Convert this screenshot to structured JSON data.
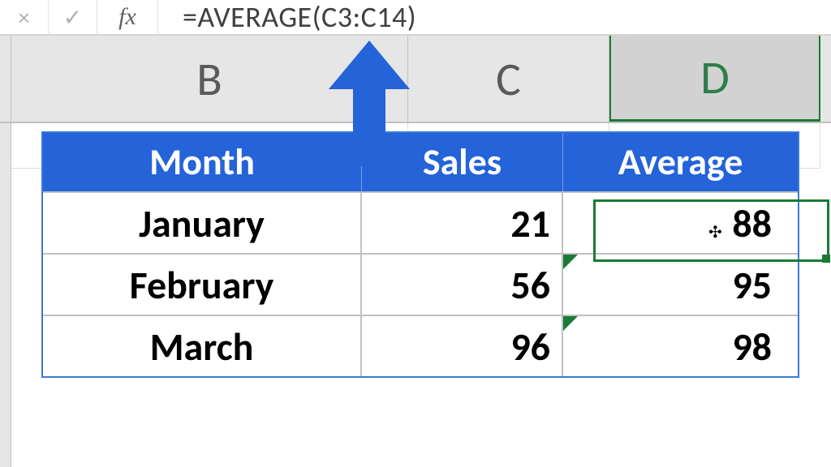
{
  "formula_bar": {
    "cancel_tip": "×",
    "confirm_tip": "✓",
    "fx_label": "fx",
    "formula": "=AVERAGE(C3:C14)"
  },
  "columns": {
    "B": "B",
    "C": "C",
    "D": "D"
  },
  "table": {
    "headers": {
      "month": "Month",
      "sales": "Sales",
      "average": "Average"
    },
    "rows": [
      {
        "month": "January",
        "sales": "21",
        "average": "88"
      },
      {
        "month": "February",
        "sales": "56",
        "average": "95"
      },
      {
        "month": "March",
        "sales": "96",
        "average": "98"
      }
    ]
  },
  "cursor_glyph": "✣",
  "colors": {
    "header_blue": "#2563d8",
    "select_green": "#1a7a36",
    "grid_gray": "#e6e6e6"
  }
}
